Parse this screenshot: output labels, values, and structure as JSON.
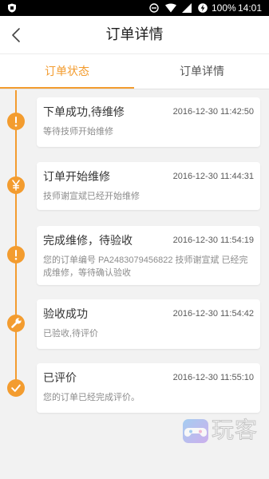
{
  "status_bar": {
    "left_icon": "shield-icon",
    "icons": [
      "do-not-disturb-icon",
      "wifi-icon",
      "signal-icon",
      "battery-charging-icon"
    ],
    "battery": "100%",
    "time": "14:01"
  },
  "header": {
    "back_icon": "back-arrow-icon",
    "title": "订单详情"
  },
  "tabs": [
    {
      "label": "订单状态",
      "active": true
    },
    {
      "label": "订单详情",
      "active": false
    }
  ],
  "timeline": [
    {
      "icon": "exclamation-icon",
      "title": "下单成功,待维修",
      "time": "2016-12-30 11:42:50",
      "desc": "等待技师开始维修"
    },
    {
      "icon": "yen-icon",
      "title": "订单开始维修",
      "time": "2016-12-30 11:44:31",
      "desc": "技师谢宣斌已经开始维修"
    },
    {
      "icon": "exclamation-icon",
      "title": "完成维修，待验收",
      "time": "2016-12-30 11:54:19",
      "desc": "您的订单编号 PA2483079456822 技师谢宣斌 已经完成维修，等待确认验收"
    },
    {
      "icon": "wrench-icon",
      "title": "验收成功",
      "time": "2016-12-30 11:54:42",
      "desc": "已验收,待评价"
    },
    {
      "icon": "check-icon",
      "title": "已评价",
      "time": "2016-12-30 11:55:10",
      "desc": "您的订单已经完成评价。"
    }
  ],
  "watermark": {
    "icon": "gamepad-icon",
    "text": "玩客"
  },
  "colors": {
    "accent": "#f39c2f",
    "background": "#f2f2f2",
    "card": "#ffffff",
    "status_bar": "#000000",
    "title_text": "#333333",
    "secondary_text": "#8c8c8c"
  }
}
